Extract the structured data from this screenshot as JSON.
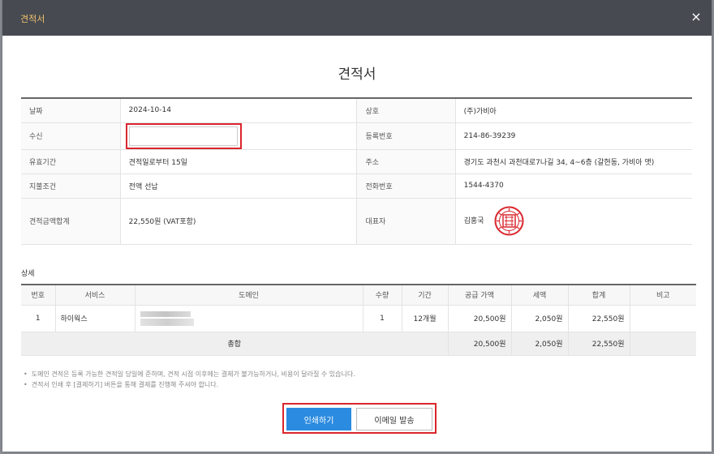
{
  "modal": {
    "title": "견적서",
    "close_icon": "×"
  },
  "document": {
    "title": "견적서"
  },
  "info": {
    "date_label": "날짜",
    "date_value": "2024-10-14",
    "recipient_label": "수신",
    "recipient_value": "",
    "validity_label": "유효기간",
    "validity_value": "견적일로부터 15일",
    "payment_label": "지불조건",
    "payment_value": "전액 선납",
    "total_label": "견적금액합계",
    "total_value": "22,550원 (VAT포함)",
    "company_label": "상호",
    "company_value": "(주)가비아",
    "regno_label": "등록번호",
    "regno_value": "214-86-39239",
    "address_label": "주소",
    "address_value": "경기도 과천시 과천대로7나길 34, 4~6층 (갈현동, 가비아 앳)",
    "phone_label": "전화번호",
    "phone_value": "1544-4370",
    "ceo_label": "대표자",
    "ceo_value": "김홍국"
  },
  "detail": {
    "section_title": "상세",
    "headers": [
      "번호",
      "서비스",
      "도메인",
      "수량",
      "기간",
      "공급 가액",
      "세액",
      "합계",
      "비고"
    ],
    "rows": [
      {
        "no": "1",
        "service": "하이웍스",
        "qty": "1",
        "period": "12개월",
        "supply": "20,500원",
        "tax": "2,050원",
        "total": "22,550원",
        "note": ""
      }
    ],
    "sum": {
      "label": "총합",
      "supply": "20,500원",
      "tax": "2,050원",
      "total": "22,550원"
    }
  },
  "notes": [
    "도메인 견적은 등록 가능한 견적일 당일에 준하며, 견적 시점 이후에는 결제가 불가능하거나, 비용이 달라질 수 있습니다.",
    "견적서 인쇄 후 [결제하기] 버튼을 통해 결제를 진행해 주셔야 합니다."
  ],
  "buttons": {
    "print": "인쇄하기",
    "email": "이메일 발송"
  },
  "colors": {
    "header_bg": "#474a51",
    "title_accent": "#f2c26b",
    "primary": "#2b8be0",
    "link": "#2f7dc0",
    "highlight": "#d9262d"
  },
  "icons": {
    "close": "close-icon",
    "stamp": "company-seal-stamp"
  }
}
